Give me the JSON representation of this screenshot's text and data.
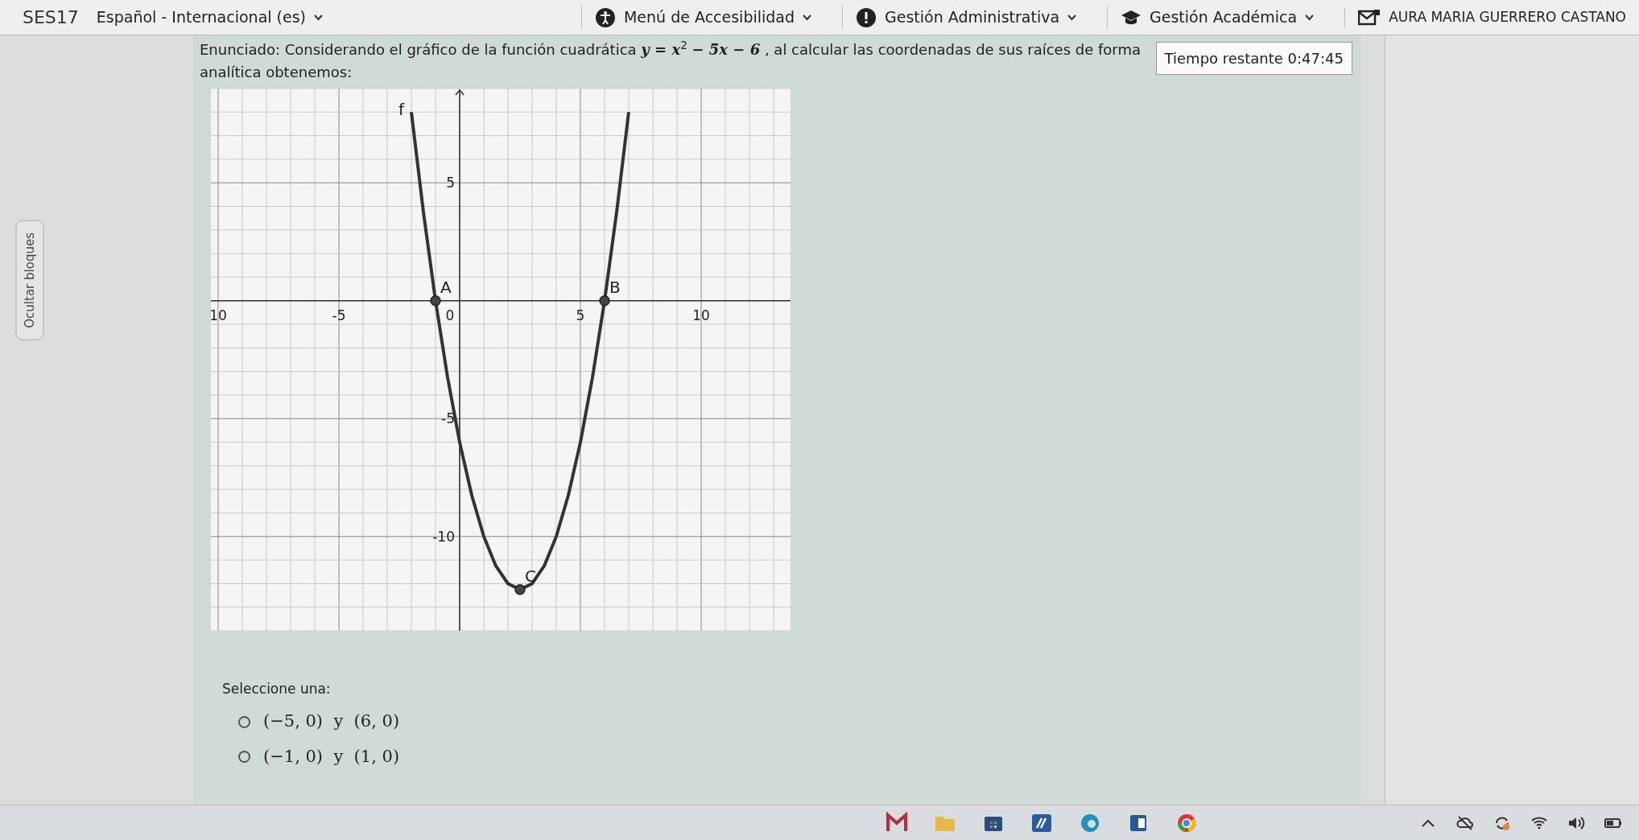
{
  "nav": {
    "brand": "SES17",
    "language": "Español - Internacional (es)",
    "menus": [
      {
        "label": "Menú de Accesibilidad"
      },
      {
        "label": "Gestión Administrativa"
      },
      {
        "label": "Gestión Académica"
      }
    ],
    "user": "AURA MARIA GUERRERO CASTANO"
  },
  "sidebar_toggle": "Ocultar bloques",
  "timer": "Tiempo restante 0:47:45",
  "question": {
    "statement": "Enunciado: Considerando el gráfico de la función cuadrática *y = x*$^{2}$ *− 5x − 6* , al calcular las coordenadas de sus raíces de forma analítica obtenemos:",
    "chart_data": {
      "type": "line",
      "x": [
        -2,
        -1.5,
        -1,
        -0.5,
        0,
        0.5,
        1,
        1.5,
        2,
        2.5,
        3,
        3.5,
        4,
        4.5,
        5,
        5.5,
        6,
        6.5,
        7
      ],
      "series": [
        {
          "name": "f",
          "color": "#333333",
          "values": [
            8,
            3.75,
            0,
            -3.25,
            -6,
            -8.25,
            -10,
            -11.25,
            -12,
            -12.25,
            -12,
            -11.25,
            -10,
            -8.25,
            -6,
            -3.25,
            0,
            3.75,
            8
          ]
        }
      ],
      "xlim": [
        -10.3,
        13.7
      ],
      "ylim": [
        -14,
        9
      ],
      "grid": true,
      "xticks": [
        {
          "value": -10,
          "label": "10"
        },
        -5,
        0,
        5,
        10
      ],
      "yticks": [
        5,
        -5,
        -10
      ],
      "annotations": [
        {
          "x": -1,
          "y": 0,
          "text": "A"
        },
        {
          "x": 6,
          "y": 0,
          "text": "B"
        },
        {
          "x": 2.5,
          "y": -12.25,
          "text": "C"
        }
      ]
    },
    "prompt": "Seleccione una:",
    "options": [
      {
        "text": "(−5, 0)  y  (6, 0)",
        "selected": false
      },
      {
        "text": "(−1, 0)  y  (1, 0)",
        "selected": false
      }
    ]
  }
}
